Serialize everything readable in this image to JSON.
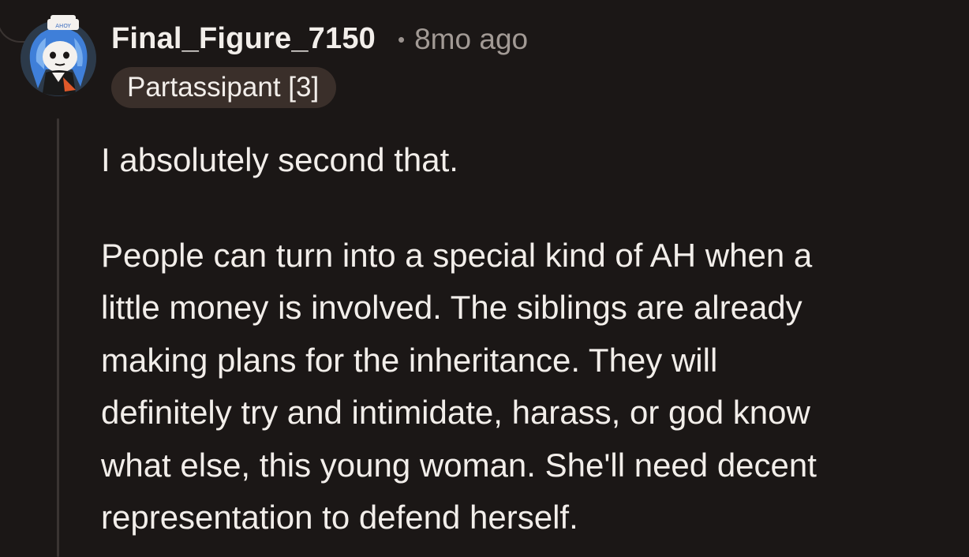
{
  "comment": {
    "author": "Final_Figure_7150",
    "separator": "•",
    "timestamp": "8mo ago",
    "flair": "Partassipant [3]",
    "avatar_icon": "snoo-avatar-sailor-hat-icon",
    "avatar_hat_text": "AHOY",
    "body": {
      "paragraph_1": "I absolutely second that.",
      "paragraph_2_lines": [
        "People can turn into a special kind of AH when a",
        "little money is involved. The siblings are already",
        "making plans for the inheritance. They will",
        "definitely try and intimidate, harass, or god know",
        "what else, this young woman. She'll need decent",
        "representation to defend herself."
      ]
    }
  },
  "colors": {
    "background": "#1b1716",
    "text": "#f2eeea",
    "muted": "#a29a95",
    "flair_bg": "#3a2f2a",
    "thread_line": "#3a3432"
  }
}
